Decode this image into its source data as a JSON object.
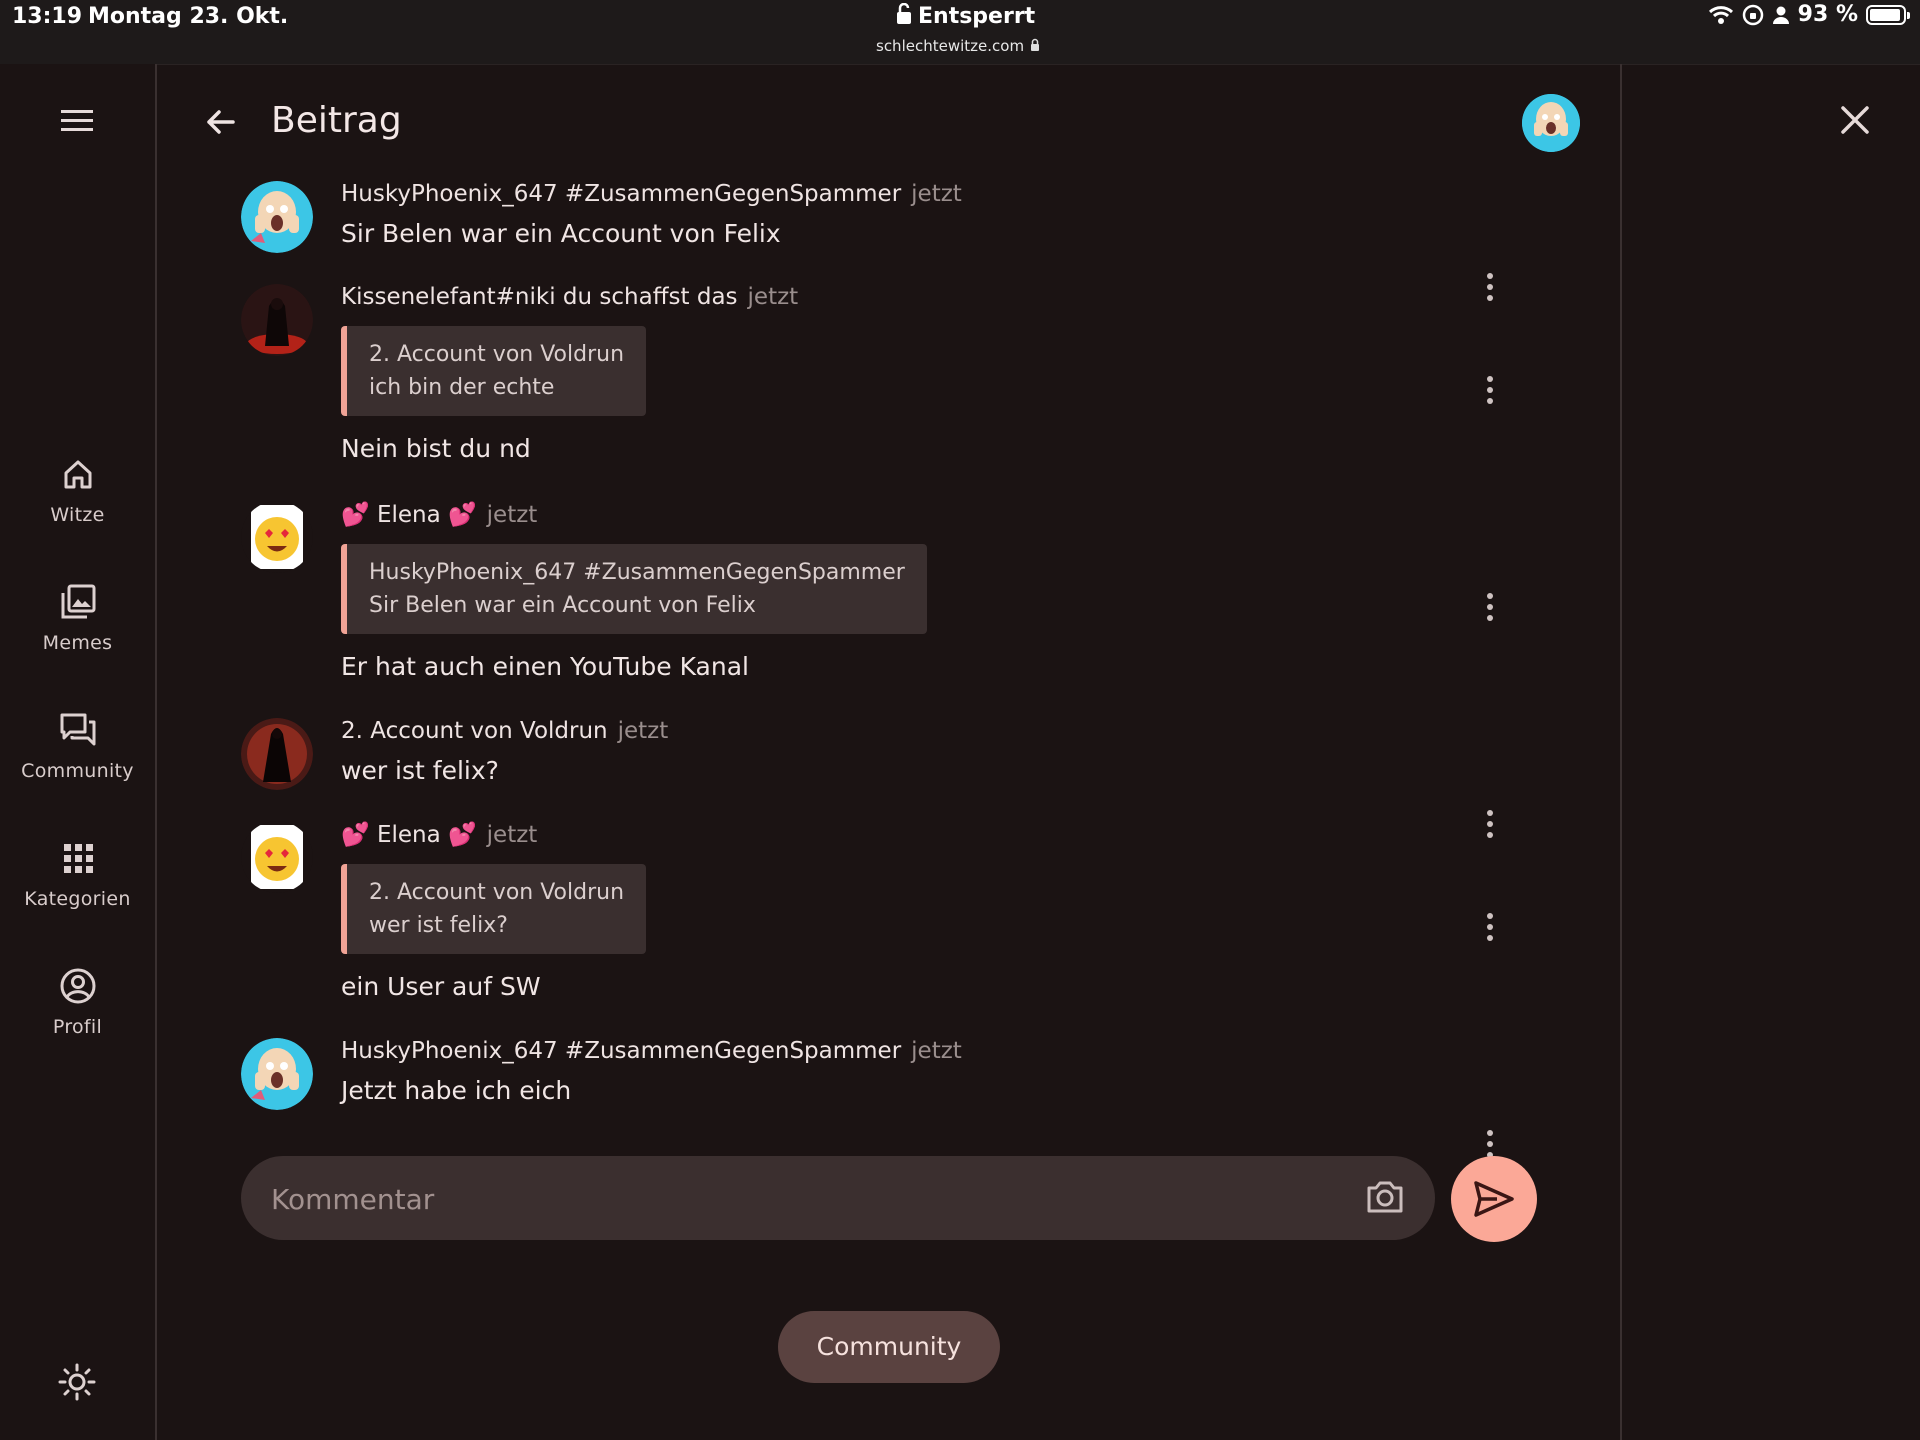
{
  "status_bar": {
    "time": "13:19",
    "date": "Montag 23. Okt.",
    "lock_label": "Entsperrt",
    "url": "schlechtewitze.com",
    "battery": "93 %",
    "battery_level": 0.93
  },
  "nav": {
    "items": [
      {
        "label": "Witze",
        "icon": "home-icon"
      },
      {
        "label": "Memes",
        "icon": "image-gallery-icon"
      },
      {
        "label": "Community",
        "icon": "forum-icon"
      },
      {
        "label": "Kategorien",
        "icon": "grid-icon"
      },
      {
        "label": "Profil",
        "icon": "account-circle-icon"
      }
    ],
    "theme_icon": "sun-icon"
  },
  "header": {
    "title": "Beitrag"
  },
  "posts": [
    {
      "author": "HuskyPhoenix_647 #ZusammenGegenSpammer",
      "time": "jetzt",
      "text": "Sir Belen war ein Account von Felix"
    },
    {
      "author": "Kissenelefant#niki du schaffst das",
      "time": "jetzt",
      "quote_author": "2. Account von Voldrun",
      "quote_text": "ich bin der echte",
      "text": "Nein bist du nd"
    },
    {
      "author": "💕 Elena 💕",
      "time": "jetzt",
      "quote_author": "HuskyPhoenix_647 #ZusammenGegenSpammer",
      "quote_text": "Sir Belen war ein Account von Felix",
      "text": "Er hat auch einen YouTube Kanal"
    },
    {
      "author": "2. Account von Voldrun",
      "time": "jetzt",
      "text": "wer ist felix?"
    },
    {
      "author": "💕 Elena 💕",
      "time": "jetzt",
      "quote_author": "2. Account von Voldrun",
      "quote_text": "wer ist felix?",
      "text": "ein User auf SW"
    },
    {
      "author": "HuskyPhoenix_647 #ZusammenGegenSpammer",
      "time": "jetzt",
      "text": "Jetzt habe ich eich"
    }
  ],
  "composer": {
    "placeholder": "Kommentar"
  },
  "chip": {
    "label": "Community"
  },
  "colors": {
    "background": "#1b1313",
    "accent": "#fba897",
    "quote_bar": "#f0a396",
    "chip": "#5a4240"
  }
}
